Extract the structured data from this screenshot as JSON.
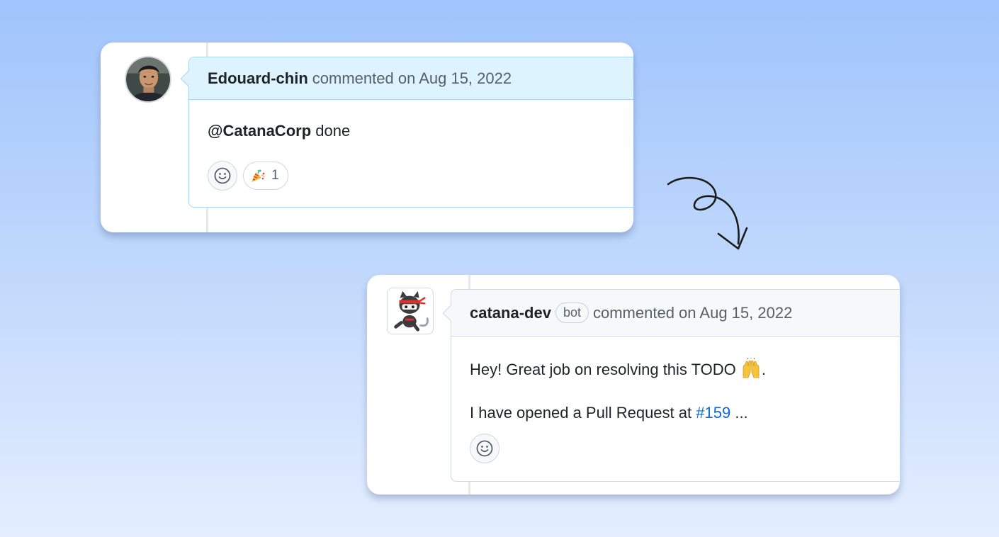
{
  "comment1": {
    "author": "Edouard-chin",
    "meta": "commented on Aug 15, 2022",
    "mention": "@CatanaCorp",
    "text": "done",
    "reaction_count": "1"
  },
  "comment2": {
    "author": "catana-dev",
    "badge": "bot",
    "meta": "commented on Aug 15, 2022",
    "line1": "Hey! Great job on resolving this TODO",
    "line1_end": ".",
    "line2_prefix": "I have opened a Pull Request at",
    "pr_link": "#159",
    "line2_suffix": "..."
  },
  "colors": {
    "link": "#0969da",
    "header_highlight": "#ddf4ff",
    "header_default": "#f6f8fa"
  },
  "icons": [
    "smiley-icon",
    "tada-icon",
    "raised-hands-icon",
    "curly-arrow"
  ]
}
